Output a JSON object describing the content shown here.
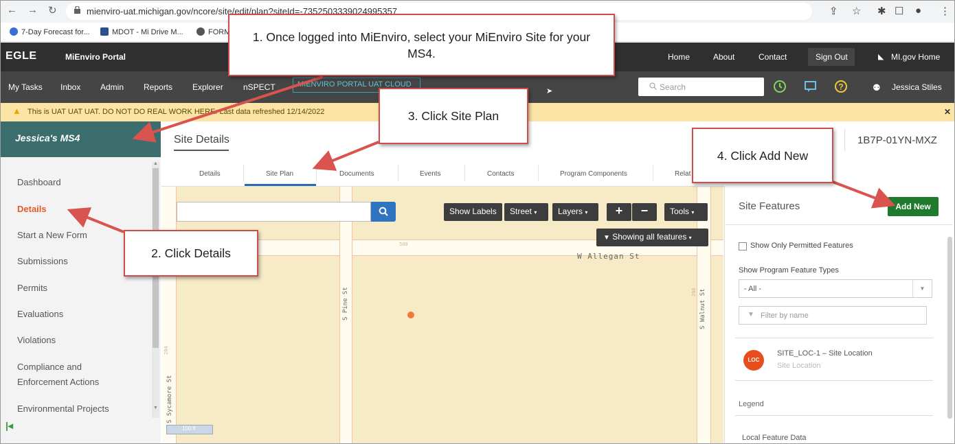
{
  "browser": {
    "url": "mienviro-uat.michigan.gov/ncore/site/edit/plan?siteId=-7352503339024995357",
    "bookmarks": [
      "7-Day Forecast for...",
      "MDOT - Mi Drive M...",
      "FORM"
    ]
  },
  "header": {
    "logo": "EGLE",
    "portal": "MiEnviro Portal",
    "links": [
      "Home",
      "About",
      "Contact",
      "Sign Out",
      "MI.gov Home"
    ]
  },
  "nav": {
    "items": [
      "My Tasks",
      "Inbox",
      "Admin",
      "Reports",
      "Explorer",
      "nSPECT"
    ],
    "badge": "MIENVIRO PORTAL UAT CLOUD",
    "search_placeholder": "Search",
    "user": "Jessica Stiles"
  },
  "warning": "This is UAT UAT UAT. DO NOT DO REAL WORK HERE. Last data refreshed 12/14/2022",
  "sidebar": {
    "site_name": "Jessica's MS4",
    "items": [
      "Dashboard",
      "Details",
      "Start a New Form",
      "Submissions",
      "Permits",
      "Evaluations",
      "Violations",
      "Compliance and",
      "Enforcement Actions",
      "Environmental Projects"
    ]
  },
  "main": {
    "title": "Site Details",
    "site_id": "1B7P-01YN-MXZ",
    "tabs": [
      "Details",
      "Site Plan",
      "Documents",
      "Events",
      "Contacts",
      "Program Components",
      "Relat"
    ]
  },
  "map": {
    "tools": [
      "Show Labels",
      "Street",
      "Layers",
      "+",
      "−",
      "Tools"
    ],
    "features_btn": "Showing all features",
    "streets": [
      "W Allegan St",
      "S Pine St",
      "S Walnut St",
      "S Sycamore St",
      "500",
      "200",
      "204"
    ],
    "scale": "100 ft"
  },
  "panel": {
    "title": "Site Features",
    "add_new": "Add New",
    "checkbox_label": "Show Only Permitted Features",
    "program_label": "Show Program Feature Types",
    "select_value": "- All -",
    "filter_placeholder": "Filter by name",
    "feature_badge": "LOC",
    "feature_name": "SITE_LOC-1 – Site Location",
    "feature_sub": "Site Location",
    "legend": "Legend",
    "local_data": "Local Feature Data"
  },
  "callouts": {
    "c1": "1. Once logged into MiEnviro, select your MiEnviro Site for your MS4.",
    "c2": "2. Click Details",
    "c3": "3. Click Site Plan",
    "c4": "4. Click Add New"
  },
  "colors": {
    "accent_orange": "#e05a2a",
    "site_header_teal": "#3a6d6b",
    "add_new_green": "#1f7a2e",
    "callout_red": "#cf4c4c"
  }
}
